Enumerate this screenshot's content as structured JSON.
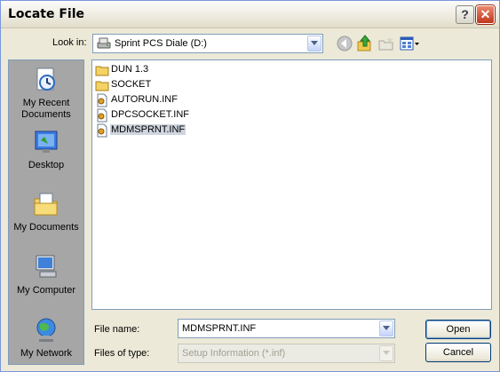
{
  "window": {
    "title": "Locate File"
  },
  "look_in": {
    "label": "Look in:",
    "value": "Sprint PCS Diale (D:)"
  },
  "toolbar": {
    "icons": [
      "back-icon",
      "up-folder-icon",
      "new-folder-icon",
      "views-menu-icon"
    ]
  },
  "places": [
    {
      "label": "My Recent Documents",
      "icon": "recent-documents-icon"
    },
    {
      "label": "Desktop",
      "icon": "desktop-icon"
    },
    {
      "label": "My Documents",
      "icon": "my-documents-icon"
    },
    {
      "label": "My Computer",
      "icon": "my-computer-icon"
    },
    {
      "label": "My Network",
      "icon": "my-network-icon"
    }
  ],
  "files": [
    {
      "name": "DUN 1.3",
      "type": "folder"
    },
    {
      "name": "SOCKET",
      "type": "folder"
    },
    {
      "name": "AUTORUN.INF",
      "type": "inf"
    },
    {
      "name": "DPCSOCKET.INF",
      "type": "inf"
    },
    {
      "name": "MDMSPRNT.INF",
      "type": "inf",
      "selected": true
    }
  ],
  "file_name": {
    "label": "File name:",
    "value": "MDMSPRNT.INF"
  },
  "file_type": {
    "label": "Files of type:",
    "value": "Setup Information (*.inf)"
  },
  "buttons": {
    "open": "Open",
    "cancel": "Cancel"
  }
}
